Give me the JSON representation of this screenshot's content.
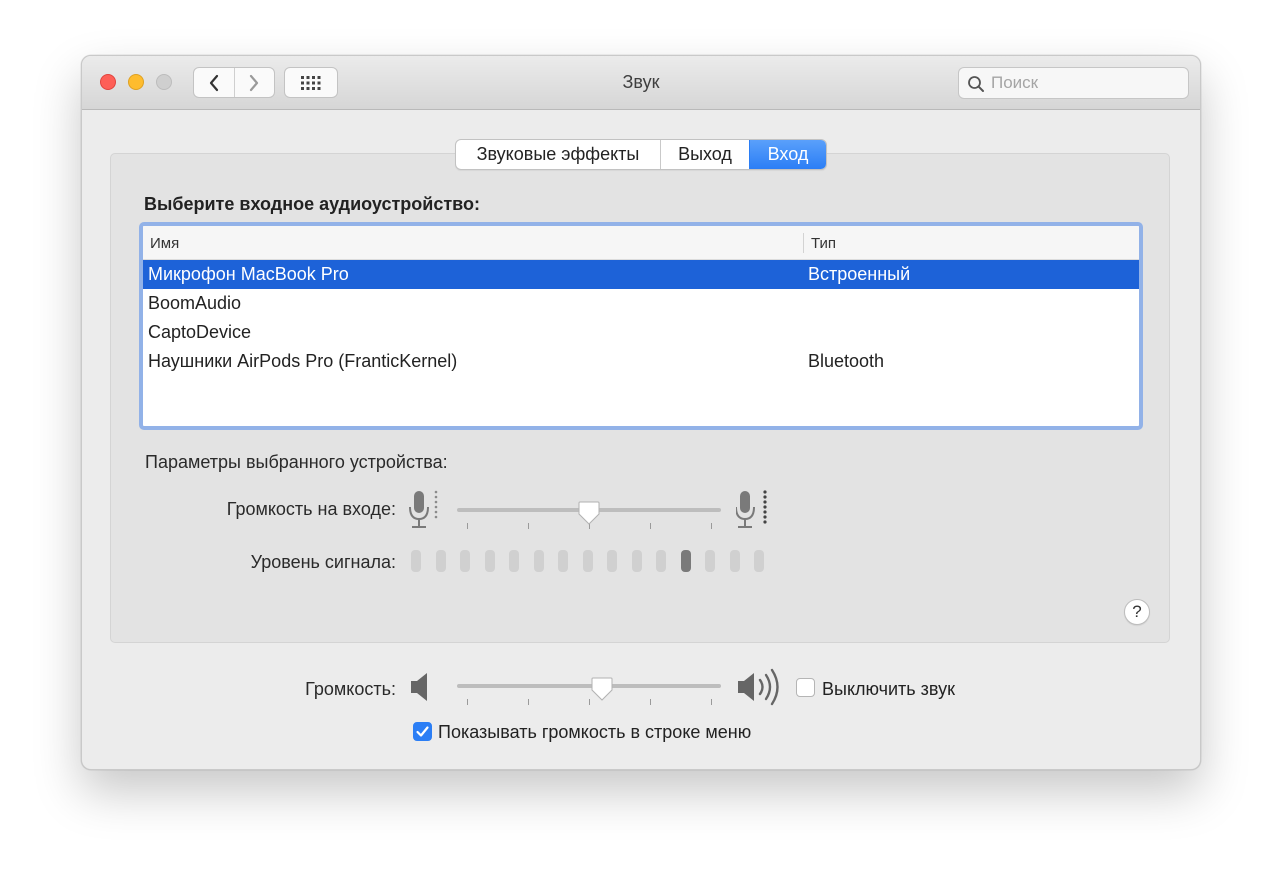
{
  "window": {
    "title": "Звук"
  },
  "search": {
    "placeholder": "Поиск",
    "value": ""
  },
  "tabs": [
    {
      "label": "Звуковые эффекты",
      "active": false
    },
    {
      "label": "Выход",
      "active": false
    },
    {
      "label": "Вход",
      "active": true
    }
  ],
  "input_section": {
    "heading": "Выберите входное аудиоустройство:",
    "columns": {
      "name": "Имя",
      "type": "Тип"
    },
    "devices": [
      {
        "name": "Микрофон MacBook Pro",
        "type": "Встроенный",
        "selected": true
      },
      {
        "name": "BoomAudio",
        "type": "",
        "selected": false
      },
      {
        "name": "CaptoDevice",
        "type": "",
        "selected": false
      },
      {
        "name": "Наушники AirPods Pro (FranticKernel)",
        "type": "Bluetooth",
        "selected": false
      }
    ]
  },
  "device_params": {
    "heading": "Параметры выбранного устройства:",
    "input_volume_label": "Громкость на входе:",
    "input_volume_fraction": 0.5,
    "signal_level_label": "Уровень сигнала:",
    "signal_level_segments": 15,
    "signal_level_active_index": 11
  },
  "help": {
    "label": "?"
  },
  "output": {
    "volume_label": "Громкость:",
    "volume_fraction": 0.55,
    "mute_label": "Выключить звук",
    "mute_checked": false,
    "show_in_menubar_label": "Показывать громкость в строке меню",
    "show_in_menubar_checked": true
  },
  "colors": {
    "accent": "#2b7ef5",
    "selection": "#1d62d8",
    "list_focus_ring": "#92b2e8",
    "traffic_close": "#fe5f57",
    "traffic_minimize": "#febc2e",
    "traffic_zoom_disabled": "#cfcfcf",
    "level_active": "#7a7a7a",
    "level_inactive": "#d0d0d0"
  },
  "icons": {
    "back": "chevron-left-icon",
    "forward": "chevron-right-icon",
    "show_all": "grid-icon",
    "search": "magnifier-icon",
    "mic_low": "microphone-low-icon",
    "mic_high": "microphone-high-icon",
    "speaker_low": "speaker-low-icon",
    "speaker_high": "speaker-high-icon"
  }
}
